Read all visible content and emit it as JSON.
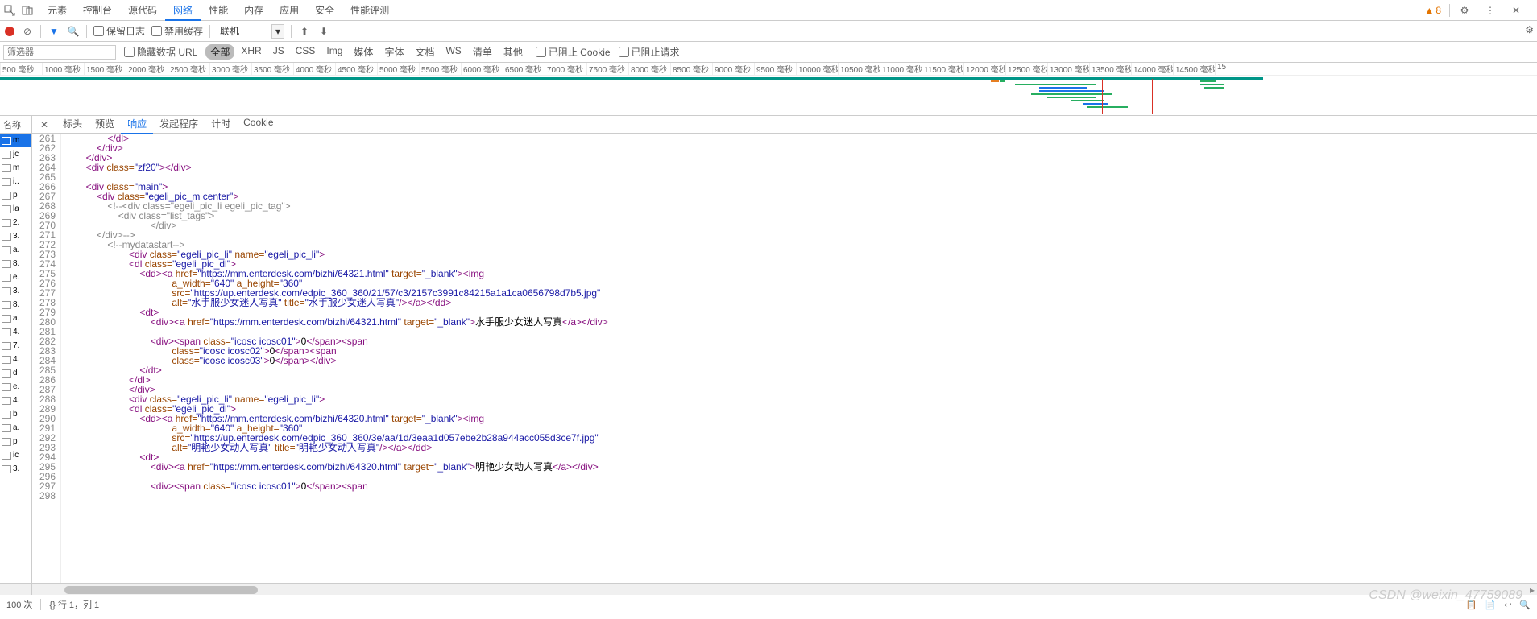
{
  "topTabs": {
    "items": [
      "元素",
      "控制台",
      "源代码",
      "网络",
      "性能",
      "内存",
      "应用",
      "安全",
      "性能评测"
    ],
    "activeIndex": 3,
    "warnCount": 8
  },
  "toolbar": {
    "preserveLog": "保留日志",
    "disableCache": "禁用缓存",
    "throttling": "联机",
    "upload": "↑",
    "download": "↓"
  },
  "filter": {
    "placeholder": "筛选器",
    "hideData": "隐藏数据 URL",
    "types": [
      "全部",
      "XHR",
      "JS",
      "CSS",
      "Img",
      "媒体",
      "字体",
      "文档",
      "WS",
      "清单",
      "其他"
    ],
    "activeType": 0,
    "blockedCookie": "已阻止 Cookie",
    "blockedReq": "已阻止请求"
  },
  "timeline": {
    "ticks": [
      "500 毫秒",
      "1000 毫秒",
      "1500 毫秒",
      "2000 毫秒",
      "2500 毫秒",
      "3000 毫秒",
      "3500 毫秒",
      "4000 毫秒",
      "4500 毫秒",
      "5000 毫秒",
      "5500 毫秒",
      "6000 毫秒",
      "6500 毫秒",
      "7000 毫秒",
      "7500 毫秒",
      "8000 毫秒",
      "8500 毫秒",
      "9000 毫秒",
      "9500 毫秒",
      "10000 毫秒",
      "10500 毫秒",
      "11000 毫秒",
      "11500 毫秒",
      "12000 毫秒",
      "12500 毫秒",
      "13000 毫秒",
      "13500 毫秒",
      "14000 毫秒",
      "14500 毫秒",
      "15"
    ]
  },
  "leftPane": {
    "header": "名称",
    "rows": [
      "m",
      "jc",
      "m",
      "i..",
      "p",
      "la",
      "2.",
      "3.",
      "a.",
      "8.",
      "e.",
      "3.",
      "8.",
      "a.",
      "4.",
      "7.",
      "4.",
      "d",
      "e.",
      "4.",
      "b",
      "a.",
      "p",
      "ic",
      "3."
    ],
    "selectedIndex": 0
  },
  "detailTabs": {
    "items": [
      "标头",
      "预览",
      "响应",
      "发起程序",
      "计时",
      "Cookie"
    ],
    "activeIndex": 2
  },
  "code": {
    "startLine": 261,
    "lines": [
      {
        "i": 4,
        "r": [
          [
            "tag",
            "</dl>"
          ]
        ]
      },
      {
        "i": 3,
        "r": [
          [
            "tag",
            "</div>"
          ]
        ]
      },
      {
        "i": 2,
        "r": [
          [
            "tag",
            "</div>"
          ]
        ]
      },
      {
        "i": 2,
        "r": [
          [
            "tag",
            "<div "
          ],
          [
            "attr",
            "class="
          ],
          [
            "val",
            "\"zf20\""
          ],
          [
            "tag",
            "></div>"
          ]
        ]
      },
      {
        "i": 0,
        "r": []
      },
      {
        "i": 2,
        "r": [
          [
            "tag",
            "<div "
          ],
          [
            "attr",
            "class="
          ],
          [
            "val",
            "\"main\""
          ],
          [
            "tag",
            ">"
          ]
        ]
      },
      {
        "i": 3,
        "r": [
          [
            "tag",
            "<div "
          ],
          [
            "attr",
            "class="
          ],
          [
            "val",
            "\"egeli_pic_m center\""
          ],
          [
            "tag",
            ">"
          ]
        ]
      },
      {
        "i": 4,
        "r": [
          [
            "cmt",
            "<!--<div class=\"egeli_pic_li egeli_pic_tag\">"
          ]
        ]
      },
      {
        "i": 5,
        "r": [
          [
            "cmt",
            "<div class=\"list_tags\">"
          ]
        ]
      },
      {
        "i": 8,
        "r": [
          [
            "cmt",
            "</div>"
          ]
        ]
      },
      {
        "i": 3,
        "r": [
          [
            "cmt",
            "</div>-->"
          ]
        ]
      },
      {
        "i": 4,
        "r": [
          [
            "cmt",
            "<!--mydatastart-->"
          ]
        ]
      },
      {
        "i": 6,
        "r": [
          [
            "tag",
            "<div "
          ],
          [
            "attr",
            "class="
          ],
          [
            "val",
            "\"egeli_pic_li\""
          ],
          [
            "tag",
            " "
          ],
          [
            "attr",
            "name="
          ],
          [
            "val",
            "\"egeli_pic_li\""
          ],
          [
            "tag",
            ">"
          ]
        ]
      },
      {
        "i": 6,
        "r": [
          [
            "tag",
            "<dl "
          ],
          [
            "attr",
            "class="
          ],
          [
            "val",
            "\"egeli_pic_dl\""
          ],
          [
            "tag",
            ">"
          ]
        ]
      },
      {
        "i": 7,
        "r": [
          [
            "tag",
            "<dd><a "
          ],
          [
            "attr",
            "href="
          ],
          [
            "val",
            "\"https://mm.enterdesk.com/bizhi/64321.html\""
          ],
          [
            "tag",
            " "
          ],
          [
            "attr",
            "target="
          ],
          [
            "val",
            "\"_blank\""
          ],
          [
            "tag",
            "><img"
          ]
        ]
      },
      {
        "i": 10,
        "r": [
          [
            "attr",
            "a_width="
          ],
          [
            "val",
            "\"640\""
          ],
          [
            "tag",
            " "
          ],
          [
            "attr",
            "a_height="
          ],
          [
            "val",
            "\"360\""
          ]
        ]
      },
      {
        "i": 10,
        "r": [
          [
            "attr",
            "src="
          ],
          [
            "val",
            "\"https://up.enterdesk.com/edpic_360_360/21/57/c3/2157c3991c84215a1a1ca0656798d7b5.jpg\""
          ]
        ]
      },
      {
        "i": 10,
        "r": [
          [
            "attr",
            "alt="
          ],
          [
            "val",
            "\"水手服少女迷人写真\""
          ],
          [
            "tag",
            " "
          ],
          [
            "attr",
            "title="
          ],
          [
            "val",
            "\"水手服少女迷人写真\""
          ],
          [
            "tag",
            "/></a></dd>"
          ]
        ]
      },
      {
        "i": 7,
        "r": [
          [
            "tag",
            "<dt>"
          ]
        ]
      },
      {
        "i": 8,
        "r": [
          [
            "tag",
            "<div><a "
          ],
          [
            "attr",
            "href="
          ],
          [
            "val",
            "\"https://mm.enterdesk.com/bizhi/64321.html\""
          ],
          [
            "tag",
            " "
          ],
          [
            "attr",
            "target="
          ],
          [
            "val",
            "\"_blank\""
          ],
          [
            "tag",
            ">"
          ],
          [
            "txt",
            "水手服少女迷人写真"
          ],
          [
            "tag",
            "</a></div>"
          ]
        ]
      },
      {
        "i": 0,
        "r": []
      },
      {
        "i": 8,
        "r": [
          [
            "tag",
            "<div><span "
          ],
          [
            "attr",
            "class="
          ],
          [
            "val",
            "\"icosc icosc01\""
          ],
          [
            "tag",
            ">"
          ],
          [
            "txt",
            "0"
          ],
          [
            "tag",
            "</span><span"
          ]
        ]
      },
      {
        "i": 10,
        "r": [
          [
            "attr",
            "class="
          ],
          [
            "val",
            "\"icosc icosc02\""
          ],
          [
            "tag",
            ">"
          ],
          [
            "txt",
            "0"
          ],
          [
            "tag",
            "</span><span"
          ]
        ]
      },
      {
        "i": 10,
        "r": [
          [
            "attr",
            "class="
          ],
          [
            "val",
            "\"icosc icosc03\""
          ],
          [
            "tag",
            ">"
          ],
          [
            "txt",
            "0"
          ],
          [
            "tag",
            "</span></div>"
          ]
        ]
      },
      {
        "i": 7,
        "r": [
          [
            "tag",
            "</dt>"
          ]
        ]
      },
      {
        "i": 6,
        "r": [
          [
            "tag",
            "</dl>"
          ]
        ]
      },
      {
        "i": 6,
        "r": [
          [
            "tag",
            "</div>"
          ]
        ]
      },
      {
        "i": 6,
        "r": [
          [
            "tag",
            "<div "
          ],
          [
            "attr",
            "class="
          ],
          [
            "val",
            "\"egeli_pic_li\""
          ],
          [
            "tag",
            " "
          ],
          [
            "attr",
            "name="
          ],
          [
            "val",
            "\"egeli_pic_li\""
          ],
          [
            "tag",
            ">"
          ]
        ]
      },
      {
        "i": 6,
        "r": [
          [
            "tag",
            "<dl "
          ],
          [
            "attr",
            "class="
          ],
          [
            "val",
            "\"egeli_pic_dl\""
          ],
          [
            "tag",
            ">"
          ]
        ]
      },
      {
        "i": 7,
        "r": [
          [
            "tag",
            "<dd><a "
          ],
          [
            "attr",
            "href="
          ],
          [
            "val",
            "\"https://mm.enterdesk.com/bizhi/64320.html\""
          ],
          [
            "tag",
            " "
          ],
          [
            "attr",
            "target="
          ],
          [
            "val",
            "\"_blank\""
          ],
          [
            "tag",
            "><img"
          ]
        ]
      },
      {
        "i": 10,
        "r": [
          [
            "attr",
            "a_width="
          ],
          [
            "val",
            "\"640\""
          ],
          [
            "tag",
            " "
          ],
          [
            "attr",
            "a_height="
          ],
          [
            "val",
            "\"360\""
          ]
        ]
      },
      {
        "i": 10,
        "r": [
          [
            "attr",
            "src="
          ],
          [
            "val",
            "\"https://up.enterdesk.com/edpic_360_360/3e/aa/1d/3eaa1d057ebe2b28a944acc055d3ce7f.jpg\""
          ]
        ]
      },
      {
        "i": 10,
        "r": [
          [
            "attr",
            "alt="
          ],
          [
            "val",
            "\"明艳少女动人写真\""
          ],
          [
            "tag",
            " "
          ],
          [
            "attr",
            "title="
          ],
          [
            "val",
            "\"明艳少女动人写真\""
          ],
          [
            "tag",
            "/></a></dd>"
          ]
        ]
      },
      {
        "i": 7,
        "r": [
          [
            "tag",
            "<dt>"
          ]
        ]
      },
      {
        "i": 8,
        "r": [
          [
            "tag",
            "<div><a "
          ],
          [
            "attr",
            "href="
          ],
          [
            "val",
            "\"https://mm.enterdesk.com/bizhi/64320.html\""
          ],
          [
            "tag",
            " "
          ],
          [
            "attr",
            "target="
          ],
          [
            "val",
            "\"_blank\""
          ],
          [
            "tag",
            ">"
          ],
          [
            "txt",
            "明艳少女动人写真"
          ],
          [
            "tag",
            "</a></div>"
          ]
        ]
      },
      {
        "i": 0,
        "r": []
      },
      {
        "i": 8,
        "r": [
          [
            "tag",
            "<div><span "
          ],
          [
            "attr",
            "class="
          ],
          [
            "val",
            "\"icosc icosc01\""
          ],
          [
            "tag",
            ">"
          ],
          [
            "txt",
            "0"
          ],
          [
            "tag",
            "</span><span"
          ]
        ]
      },
      {
        "i": 0,
        "r": []
      }
    ]
  },
  "status": {
    "count": "100 次",
    "cursor": "{}  行 1，列 1",
    "watermark": "CSDN @weixin_47759089"
  }
}
